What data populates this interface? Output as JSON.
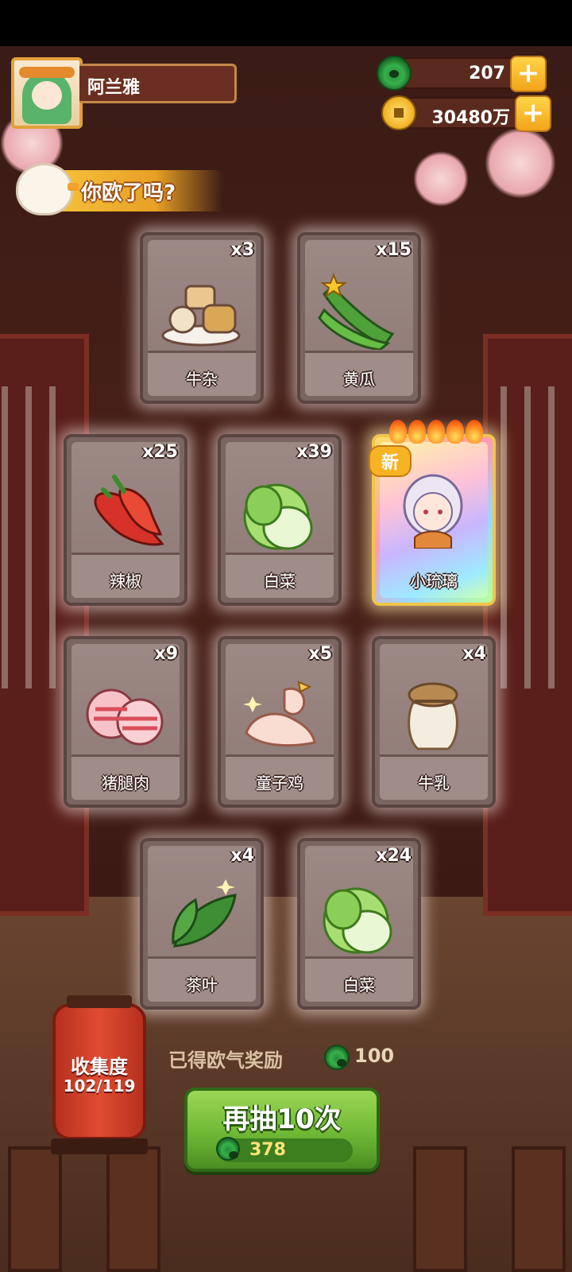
{
  "player": {
    "name": "阿兰雅"
  },
  "currencies": [
    {
      "icon": "jade-icon",
      "value": "207"
    },
    {
      "icon": "coin-icon",
      "value": "30480万"
    }
  ],
  "banner": {
    "text": "你欧了吗?"
  },
  "cards": [
    {
      "name": "牛杂",
      "count": "x3",
      "icon": "beef-offal-icon"
    },
    {
      "name": "黄瓜",
      "count": "x15",
      "icon": "cucumber-icon"
    },
    {
      "name": "辣椒",
      "count": "x25",
      "icon": "chili-icon"
    },
    {
      "name": "白菜",
      "count": "x39",
      "icon": "cabbage-icon"
    },
    {
      "name": "小琉璃",
      "count": "",
      "icon": "character-portrait-icon",
      "tag": "新",
      "special": true
    },
    {
      "name": "猪腿肉",
      "count": "x9",
      "icon": "pork-leg-icon"
    },
    {
      "name": "童子鸡",
      "count": "x5",
      "icon": "chicken-icon"
    },
    {
      "name": "牛乳",
      "count": "x4",
      "icon": "milk-jar-icon"
    },
    {
      "name": "茶叶",
      "count": "x4",
      "icon": "tea-leaf-icon"
    },
    {
      "name": "白菜",
      "count": "x24",
      "icon": "cabbage-icon"
    }
  ],
  "collection": {
    "label": "收集度",
    "progress": "102/119"
  },
  "reward": {
    "label": "已得欧气奖励",
    "value": "100"
  },
  "draw_button": {
    "label": "再抽10次",
    "cost": "378"
  },
  "colors": {
    "accent_green": "#6fb835",
    "gold": "#f6c13b",
    "card_bg": "#8e7975"
  }
}
